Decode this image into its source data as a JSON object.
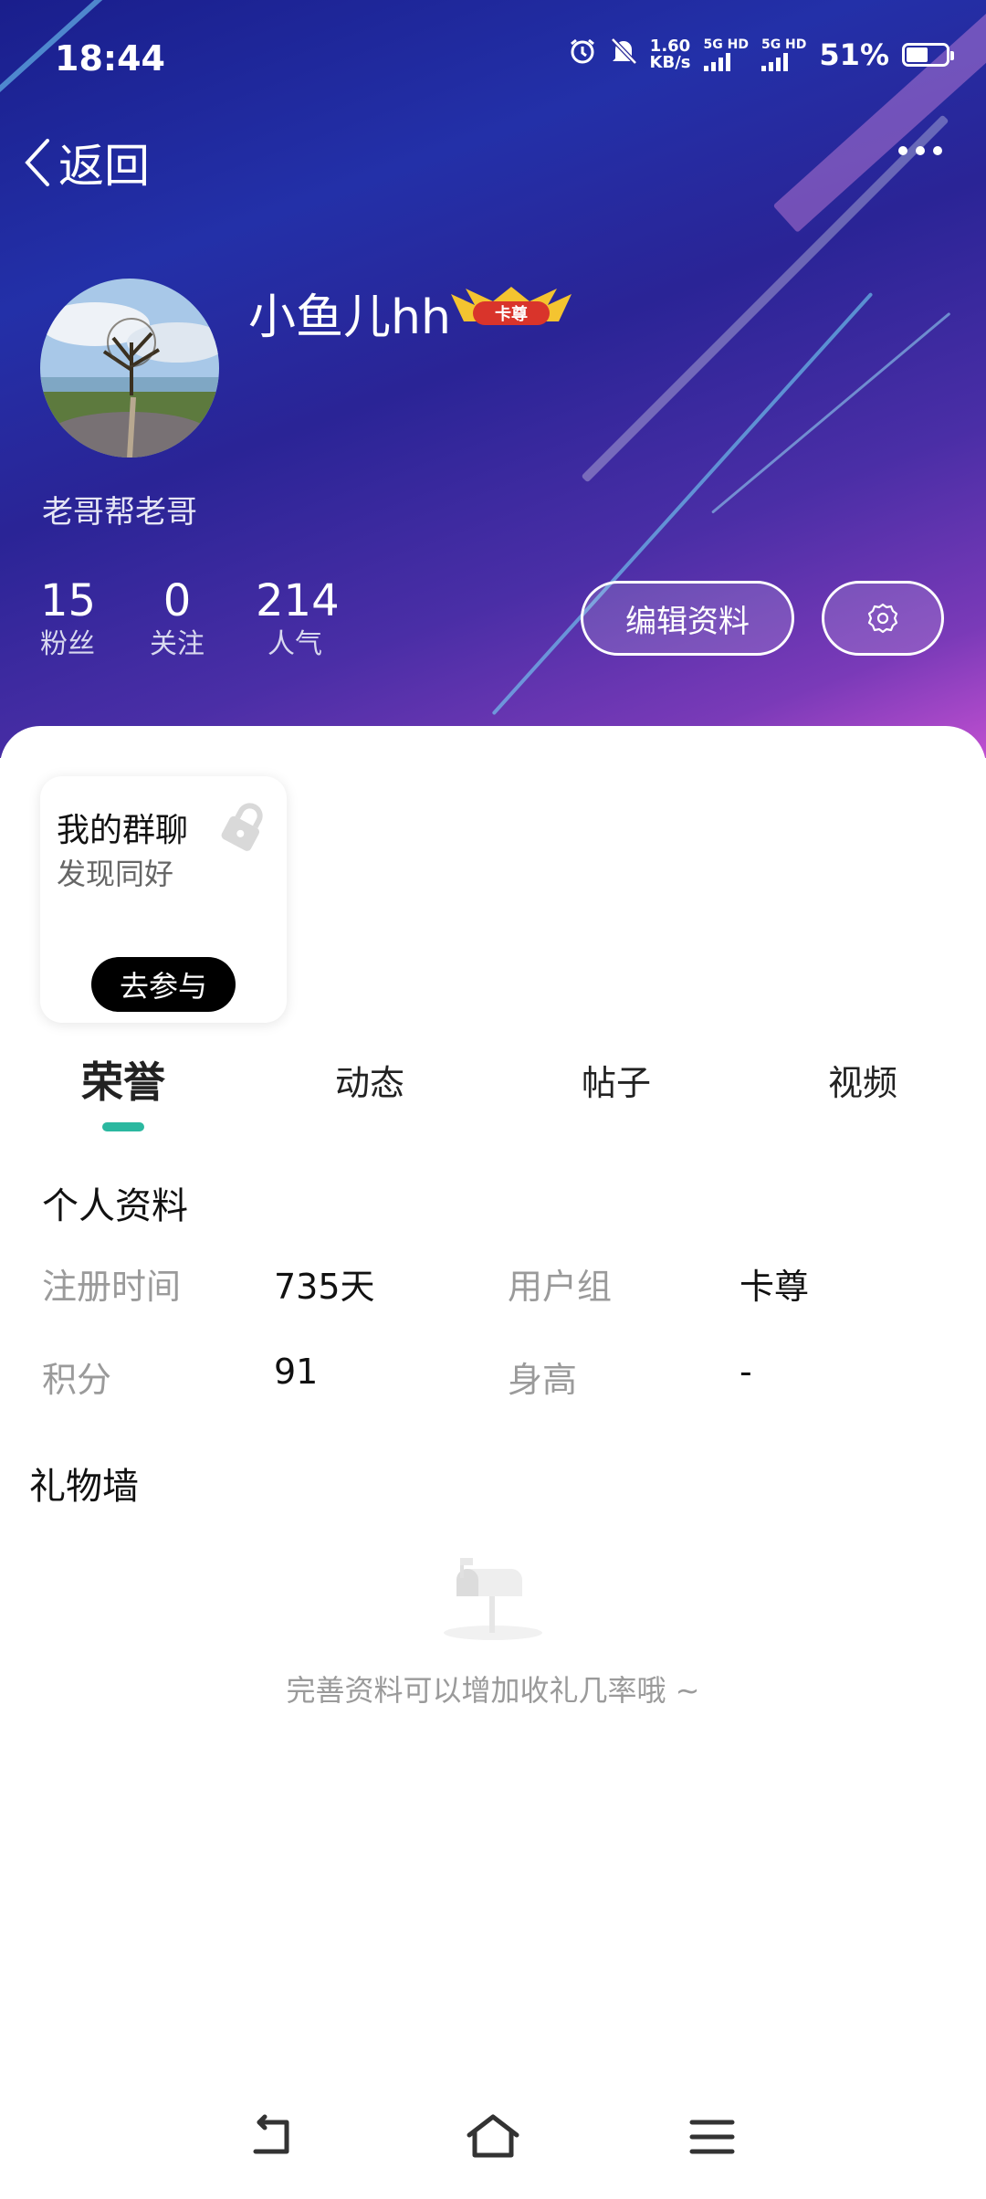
{
  "status_bar": {
    "time": "18:44",
    "net_speed_value": "1.60",
    "net_speed_unit": "KB/s",
    "sim1": "5G HD",
    "sim2": "5G HD",
    "battery": "51%",
    "icons": [
      "alarm-icon",
      "mute-icon",
      "signal-icon",
      "battery-icon"
    ]
  },
  "header": {
    "back_label": "返回",
    "more_icon": "more-icon"
  },
  "profile": {
    "username": "小鱼儿hh",
    "badge_text": "卡尊",
    "signature": "老哥帮老哥",
    "stats": [
      {
        "value": "15",
        "label": "粉丝"
      },
      {
        "value": "0",
        "label": "关注"
      },
      {
        "value": "214",
        "label": "人气"
      }
    ],
    "edit_label": "编辑资料",
    "settings_icon": "gear-icon"
  },
  "group_card": {
    "title": "我的群聊",
    "subtitle": "发现同好",
    "button": "去参与",
    "icon": "lock-icon"
  },
  "tabs": [
    {
      "label": "荣誉",
      "active": true
    },
    {
      "label": "动态",
      "active": false
    },
    {
      "label": "帖子",
      "active": false
    },
    {
      "label": "视频",
      "active": false
    }
  ],
  "personal_info": {
    "title": "个人资料",
    "fields": [
      {
        "label": "注册时间",
        "value": "735天"
      },
      {
        "label": "用户组",
        "value": "卡尊"
      },
      {
        "label": "积分",
        "value": "91"
      },
      {
        "label": "身高",
        "value": "-"
      }
    ]
  },
  "gift_wall": {
    "title": "礼物墙",
    "empty_text": "完善资料可以增加收礼几率哦 ~",
    "icon": "mailbox-icon"
  },
  "nav_bar": [
    "back-nav-icon",
    "home-nav-icon",
    "menu-nav-icon"
  ],
  "colors": {
    "accent": "#2bb8a0",
    "hero_gradient_start": "#1a1e8c",
    "hero_gradient_end": "#c04fd0"
  }
}
